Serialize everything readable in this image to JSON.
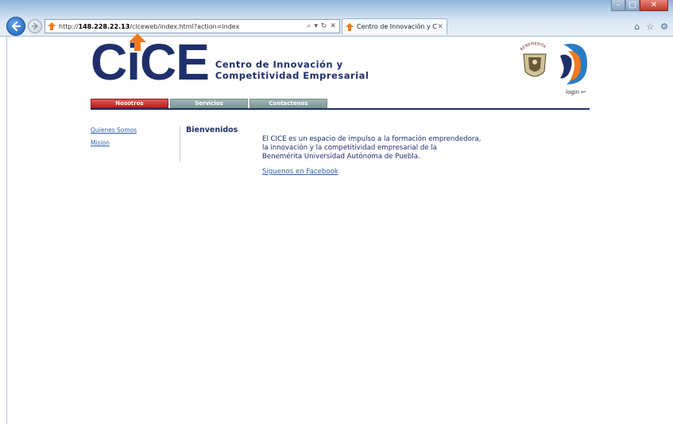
{
  "browser": {
    "window_controls": {
      "minimize": "–",
      "maximize": "□",
      "close": "✕"
    },
    "address": {
      "prefix": "http://",
      "host": "148.228.22.13",
      "path": "/ciceweb/index.html?action=index",
      "search_icon": "search-icon",
      "refresh_icon": "refresh-icon",
      "stop_icon": "stop-icon"
    },
    "tab": {
      "title": "Centro de Innovación y Co...",
      "close": "✕"
    },
    "tools": {
      "home": "⌂",
      "favorites": "☆",
      "settings": "⚙"
    }
  },
  "header": {
    "logo_letters": {
      "c1": "C",
      "i": "i",
      "c2": "C",
      "e": "E"
    },
    "logo_text_line1": "Centro de Innovación y",
    "logo_text_line2": "Competitividad Empresarial",
    "seal_text": "BENEMERITA",
    "login": "login",
    "colors": {
      "brand_blue": "#1f2f6b",
      "accent_orange": "#f07a1a",
      "active_tab_red": "#c42a2a",
      "tab_gray": "#8aa3a3"
    }
  },
  "nav": {
    "tabs": [
      {
        "label": "Nosotros",
        "active": true
      },
      {
        "label": "Servicios",
        "active": false
      },
      {
        "label": "Contactenos",
        "active": false
      }
    ]
  },
  "sidebar": {
    "links": [
      "Quienes Somos",
      "Mision"
    ]
  },
  "main": {
    "title": "Bienvenidos",
    "paragraph_lines": [
      "El CICE es un espacio de impulso a la formación emprendedora,",
      "la innovación y la competitividad empresarial de la",
      "Benemérita Universidad Autónoma de Puebla."
    ],
    "facebook_link": "Siguenos en Facebook"
  }
}
